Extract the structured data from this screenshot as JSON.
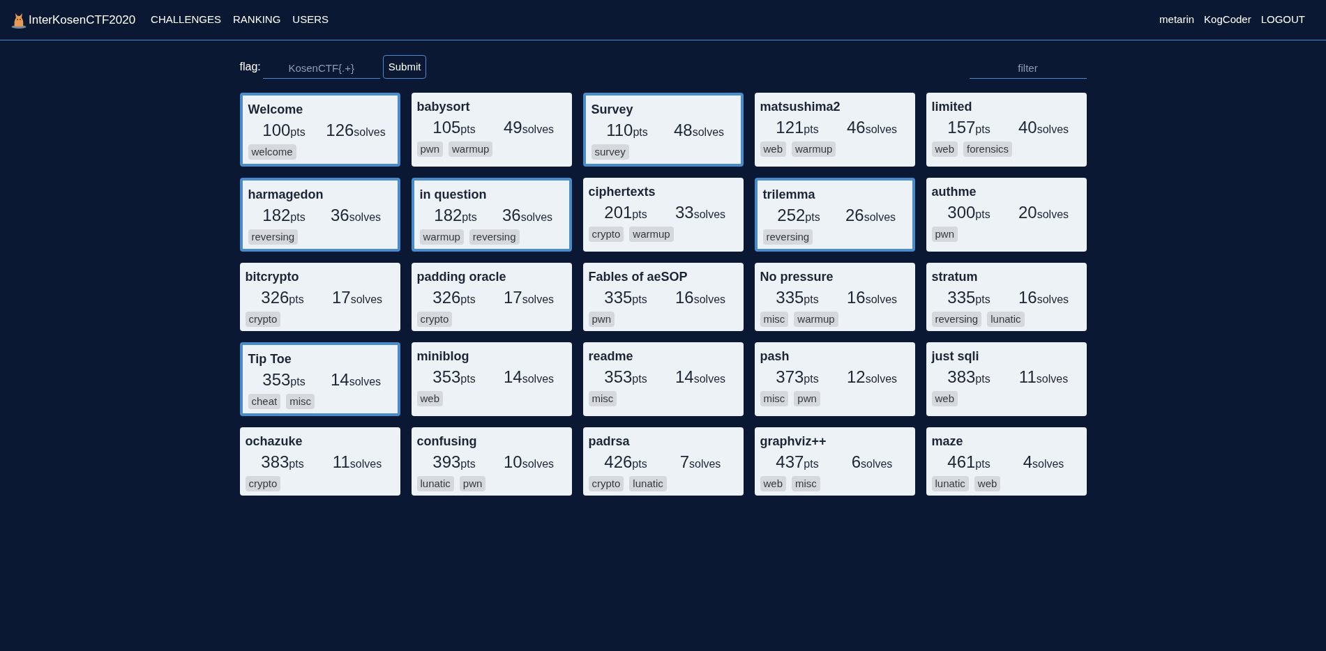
{
  "header": {
    "brand": "InterKosenCTF2020",
    "nav": [
      "CHALLENGES",
      "RANKING",
      "USERS"
    ],
    "user_menu": [
      "metarin",
      "KogCoder",
      "LOGOUT"
    ]
  },
  "flag_form": {
    "label": "flag:",
    "placeholder": "KosenCTF{.+}",
    "button": "Submit"
  },
  "filter": {
    "placeholder": "filter"
  },
  "challenges": [
    {
      "name": "Welcome",
      "points": "100",
      "points_unit": "pts",
      "solves": "126",
      "solves_unit": "solves",
      "tags": [
        "welcome"
      ],
      "solved": true
    },
    {
      "name": "babysort",
      "points": "105",
      "points_unit": "pts",
      "solves": "49",
      "solves_unit": "solves",
      "tags": [
        "pwn",
        "warmup"
      ],
      "solved": false
    },
    {
      "name": "Survey",
      "points": "110",
      "points_unit": "pts",
      "solves": "48",
      "solves_unit": "solves",
      "tags": [
        "survey"
      ],
      "solved": true
    },
    {
      "name": "matsushima2",
      "points": "121",
      "points_unit": "pts",
      "solves": "46",
      "solves_unit": "solves",
      "tags": [
        "web",
        "warmup"
      ],
      "solved": false
    },
    {
      "name": "limited",
      "points": "157",
      "points_unit": "pts",
      "solves": "40",
      "solves_unit": "solves",
      "tags": [
        "web",
        "forensics"
      ],
      "solved": false
    },
    {
      "name": "harmagedon",
      "points": "182",
      "points_unit": "pts",
      "solves": "36",
      "solves_unit": "solves",
      "tags": [
        "reversing"
      ],
      "solved": true
    },
    {
      "name": "in question",
      "points": "182",
      "points_unit": "pts",
      "solves": "36",
      "solves_unit": "solves",
      "tags": [
        "warmup",
        "reversing"
      ],
      "solved": true
    },
    {
      "name": "ciphertexts",
      "points": "201",
      "points_unit": "pts",
      "solves": "33",
      "solves_unit": "solves",
      "tags": [
        "crypto",
        "warmup"
      ],
      "solved": false
    },
    {
      "name": "trilemma",
      "points": "252",
      "points_unit": "pts",
      "solves": "26",
      "solves_unit": "solves",
      "tags": [
        "reversing"
      ],
      "solved": true
    },
    {
      "name": "authme",
      "points": "300",
      "points_unit": "pts",
      "solves": "20",
      "solves_unit": "solves",
      "tags": [
        "pwn"
      ],
      "solved": false
    },
    {
      "name": "bitcrypto",
      "points": "326",
      "points_unit": "pts",
      "solves": "17",
      "solves_unit": "solves",
      "tags": [
        "crypto"
      ],
      "solved": false
    },
    {
      "name": "padding oracle",
      "points": "326",
      "points_unit": "pts",
      "solves": "17",
      "solves_unit": "solves",
      "tags": [
        "crypto"
      ],
      "solved": false
    },
    {
      "name": "Fables of aeSOP",
      "points": "335",
      "points_unit": "pts",
      "solves": "16",
      "solves_unit": "solves",
      "tags": [
        "pwn"
      ],
      "solved": false
    },
    {
      "name": "No pressure",
      "points": "335",
      "points_unit": "pts",
      "solves": "16",
      "solves_unit": "solves",
      "tags": [
        "misc",
        "warmup"
      ],
      "solved": false
    },
    {
      "name": "stratum",
      "points": "335",
      "points_unit": "pts",
      "solves": "16",
      "solves_unit": "solves",
      "tags": [
        "reversing",
        "lunatic"
      ],
      "solved": false
    },
    {
      "name": "Tip Toe",
      "points": "353",
      "points_unit": "pts",
      "solves": "14",
      "solves_unit": "solves",
      "tags": [
        "cheat",
        "misc"
      ],
      "solved": true
    },
    {
      "name": "miniblog",
      "points": "353",
      "points_unit": "pts",
      "solves": "14",
      "solves_unit": "solves",
      "tags": [
        "web"
      ],
      "solved": false
    },
    {
      "name": "readme",
      "points": "353",
      "points_unit": "pts",
      "solves": "14",
      "solves_unit": "solves",
      "tags": [
        "misc"
      ],
      "solved": false
    },
    {
      "name": "pash",
      "points": "373",
      "points_unit": "pts",
      "solves": "12",
      "solves_unit": "solves",
      "tags": [
        "misc",
        "pwn"
      ],
      "solved": false
    },
    {
      "name": "just sqli",
      "points": "383",
      "points_unit": "pts",
      "solves": "11",
      "solves_unit": "solves",
      "tags": [
        "web"
      ],
      "solved": false
    },
    {
      "name": "ochazuke",
      "points": "383",
      "points_unit": "pts",
      "solves": "11",
      "solves_unit": "solves",
      "tags": [
        "crypto"
      ],
      "solved": false
    },
    {
      "name": "confusing",
      "points": "393",
      "points_unit": "pts",
      "solves": "10",
      "solves_unit": "solves",
      "tags": [
        "lunatic",
        "pwn"
      ],
      "solved": false
    },
    {
      "name": "padrsa",
      "points": "426",
      "points_unit": "pts",
      "solves": "7",
      "solves_unit": "solves",
      "tags": [
        "crypto",
        "lunatic"
      ],
      "solved": false
    },
    {
      "name": "graphviz++",
      "points": "437",
      "points_unit": "pts",
      "solves": "6",
      "solves_unit": "solves",
      "tags": [
        "web",
        "misc"
      ],
      "solved": false
    },
    {
      "name": "maze",
      "points": "461",
      "points_unit": "pts",
      "solves": "4",
      "solves_unit": "solves",
      "tags": [
        "lunatic",
        "web"
      ],
      "solved": false
    }
  ]
}
